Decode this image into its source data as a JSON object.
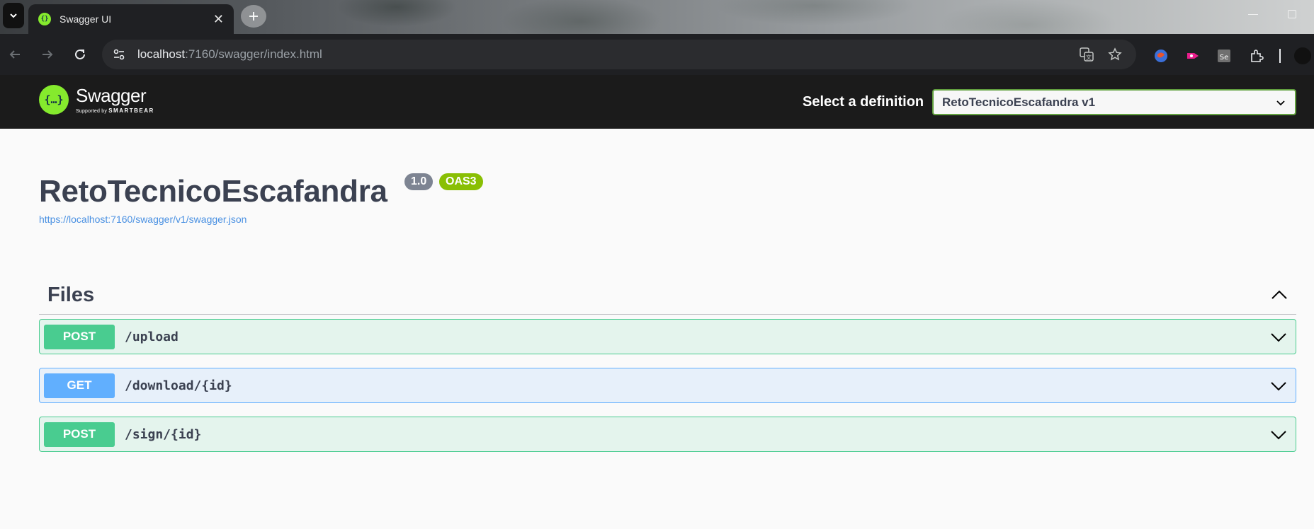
{
  "browser": {
    "tab_title": "Swagger UI",
    "url_host": "localhost",
    "url_rest": ":7160/swagger/index.html"
  },
  "topbar": {
    "brand": "Swagger",
    "brand_sub_prefix": "Supported by",
    "brand_sub_company": "SMARTBEAR",
    "definition_label": "Select a definition",
    "definition_value": "RetoTecnicoEscafandra v1"
  },
  "info": {
    "title": "RetoTecnicoEscafandra",
    "version": "1.0",
    "oas_badge": "OAS3",
    "spec_url": "https://localhost:7160/swagger/v1/swagger.json"
  },
  "tag": {
    "name": "Files",
    "operations": [
      {
        "method": "POST",
        "path": "/upload"
      },
      {
        "method": "GET",
        "path": "/download/{id}"
      },
      {
        "method": "POST",
        "path": "/sign/{id}"
      }
    ]
  },
  "colors": {
    "post": "#49cc90",
    "get": "#61affe",
    "swagger_green": "#85ea2d",
    "topbar_bg": "#1b1b1b",
    "text": "#3b4151"
  }
}
